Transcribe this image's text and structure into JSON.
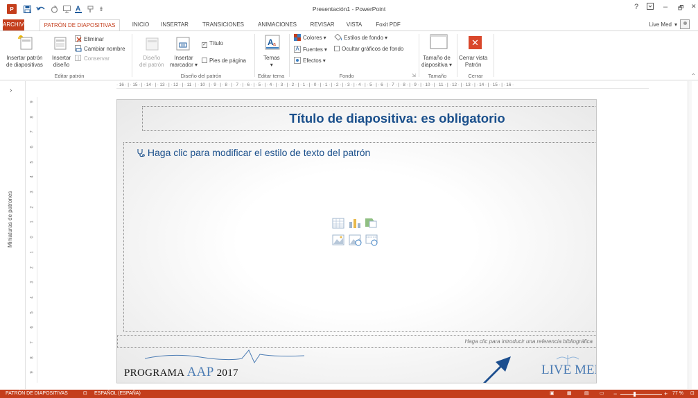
{
  "window": {
    "title": "Presentación1 - PowerPoint",
    "logo_text": "P",
    "help": "?",
    "minimize": "–",
    "restore": "🗗",
    "close": "✕"
  },
  "quick_access": [
    "save-icon",
    "undo-icon",
    "redo-icon",
    "start-from-beginning-icon",
    "font-color-icon",
    "painter-icon",
    "customize-icon"
  ],
  "tabs": {
    "file": "ARCHIVO",
    "items": [
      "PATRÓN DE DIAPOSITIVAS",
      "INICIO",
      "INSERTAR",
      "TRANSICIONES",
      "ANIMACIONES",
      "REVISAR",
      "VISTA",
      "Foxit PDF"
    ]
  },
  "account": {
    "name": "Live Med",
    "caret": "▾"
  },
  "ribbon": {
    "edit_master": {
      "insert_master": [
        "Insertar patrón",
        "de diapositivas"
      ],
      "insert_layout": [
        "Insertar",
        "diseño"
      ],
      "delete": "Eliminar",
      "rename": "Cambiar nombre",
      "preserve": "Conservar",
      "label": "Editar patrón"
    },
    "master_layout": {
      "master_layout_btn": [
        "Diseño",
        "del patrón"
      ],
      "insert_placeholder": [
        "Insertar",
        "marcador"
      ],
      "title_check": "Título",
      "title_checked": "✓",
      "footers_check": "Pies de página",
      "label": "Diseño del patrón"
    },
    "edit_theme": {
      "themes": "Temas",
      "label": "Editar tema"
    },
    "background": {
      "colors": "Colores",
      "fonts": "Fuentes",
      "effects": "Efectos",
      "bg_styles": "Estilos de fondo",
      "hide_graphics": "Ocultar gráficos de fondo",
      "label": "Fondo"
    },
    "size": {
      "slide_size": [
        "Tamaño de",
        "diapositiva"
      ],
      "label": "Tamaño"
    },
    "close": {
      "close_master": [
        "Cerrar vista",
        "Patrón"
      ],
      "label": "Cerrar"
    }
  },
  "thumbnails": {
    "label": "Miniaturas de patrones",
    "expand": "›"
  },
  "ruler": "· 16 · | · 15 · | · 14 · | · 13 · | · 12 · | · 11 · | · 10 · | · 9 · | · 8 · | · 7 · | · 6 · | · 5 · | · 4 · | · 3 · | · 2 · | · 1 · | · 0 · | · 1 · | · 2 · | · 3 · | · 4 · | · 5 · | · 6 · | · 7 · | · 8 · | · 9 · | · 10 · | · 11 · | · 12 · | · 13 · | · 14 · | · 15 · | · 16 ·",
  "vruler": [
    "9",
    "8",
    "7",
    "6",
    "5",
    "4",
    "3",
    "2",
    "1",
    "0",
    "1",
    "2",
    "3",
    "4",
    "5",
    "6",
    "7",
    "8",
    "9"
  ],
  "slide": {
    "title": "Título de diapositiva: es obligatorio",
    "body": "Haga clic para modificar el estilo de texto del patrón",
    "bullet_icon": "stethoscope-icon",
    "footer": "Haga clic para introducir una referencia bibliográfica",
    "logo_left": {
      "a": "PROGRAMA ",
      "b": "AAP",
      "c": " 2017"
    },
    "logo_right": "LIVE MED"
  },
  "status": {
    "view": "PATRÓN DE DIAPOSITIVAS",
    "language": "ESPAÑOL (ESPAÑA)",
    "zoom": "77 %",
    "zoom_minus": "−",
    "zoom_plus": "+"
  },
  "colors": {
    "accent": "#c43e1c",
    "slide_title": "#1a4f8b",
    "logo_blue": "#4a7bb3"
  }
}
